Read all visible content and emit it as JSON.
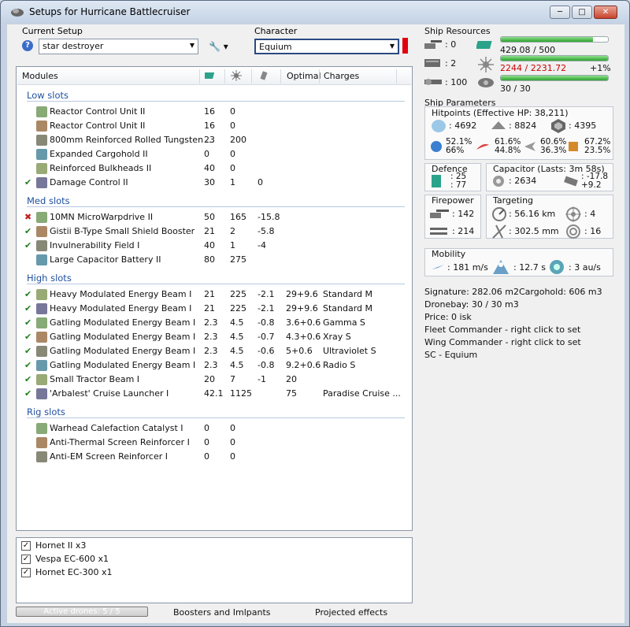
{
  "window": {
    "title": "Setups for Hurricane Battlecruiser"
  },
  "setup": {
    "label": "Current Setup",
    "value": "star destroyer"
  },
  "character": {
    "label": "Character",
    "value": "Equium"
  },
  "modules": {
    "headers": {
      "modules": "Modules",
      "optimal": "Optimal",
      "charges": "Charges"
    },
    "groups": [
      {
        "name": "Low slots",
        "rows": [
          {
            "mark": "",
            "name": "Reactor Control Unit II",
            "cpu": "16",
            "pg": "0",
            "cap": "",
            "opt": "",
            "charge": ""
          },
          {
            "mark": "",
            "name": "Reactor Control Unit II",
            "cpu": "16",
            "pg": "0",
            "cap": "",
            "opt": "",
            "charge": ""
          },
          {
            "mark": "",
            "name": "800mm Reinforced Rolled Tungsten ...",
            "cpu": "23",
            "pg": "200",
            "cap": "",
            "opt": "",
            "charge": ""
          },
          {
            "mark": "",
            "name": "Expanded Cargohold II",
            "cpu": "0",
            "pg": "0",
            "cap": "",
            "opt": "",
            "charge": ""
          },
          {
            "mark": "",
            "name": "Reinforced Bulkheads II",
            "cpu": "40",
            "pg": "0",
            "cap": "",
            "opt": "",
            "charge": ""
          },
          {
            "mark": "✔",
            "name": "Damage Control II",
            "cpu": "30",
            "pg": "1",
            "cap": "0",
            "opt": "",
            "charge": ""
          }
        ]
      },
      {
        "name": "Med slots",
        "rows": [
          {
            "mark": "✖",
            "name": "10MN MicroWarpdrive II",
            "cpu": "50",
            "pg": "165",
            "cap": "-15.8",
            "opt": "",
            "charge": ""
          },
          {
            "mark": "✔",
            "name": "Gistii B-Type Small Shield Booster",
            "cpu": "21",
            "pg": "2",
            "cap": "-5.8",
            "opt": "",
            "charge": ""
          },
          {
            "mark": "✔",
            "name": "Invulnerability Field I",
            "cpu": "40",
            "pg": "1",
            "cap": "-4",
            "opt": "",
            "charge": ""
          },
          {
            "mark": "",
            "name": "Large Capacitor Battery II",
            "cpu": "80",
            "pg": "275",
            "cap": "",
            "opt": "",
            "charge": ""
          }
        ]
      },
      {
        "name": "High slots",
        "rows": [
          {
            "mark": "✔",
            "name": "Heavy Modulated Energy Beam I",
            "cpu": "21",
            "pg": "225",
            "cap": "-2.1",
            "opt": "29+9.6",
            "charge": "Standard M"
          },
          {
            "mark": "✔",
            "name": "Heavy Modulated Energy Beam I",
            "cpu": "21",
            "pg": "225",
            "cap": "-2.1",
            "opt": "29+9.6",
            "charge": "Standard M"
          },
          {
            "mark": "✔",
            "name": "Gatling Modulated Energy Beam I",
            "cpu": "2.3",
            "pg": "4.5",
            "cap": "-0.8",
            "opt": "3.6+0.6",
            "charge": "Gamma S"
          },
          {
            "mark": "✔",
            "name": "Gatling Modulated Energy Beam I",
            "cpu": "2.3",
            "pg": "4.5",
            "cap": "-0.7",
            "opt": "4.3+0.6",
            "charge": "Xray S"
          },
          {
            "mark": "✔",
            "name": "Gatling Modulated Energy Beam I",
            "cpu": "2.3",
            "pg": "4.5",
            "cap": "-0.6",
            "opt": "5+0.6",
            "charge": "Ultraviolet S"
          },
          {
            "mark": "✔",
            "name": "Gatling Modulated Energy Beam I",
            "cpu": "2.3",
            "pg": "4.5",
            "cap": "-0.8",
            "opt": "9.2+0.6",
            "charge": "Radio S"
          },
          {
            "mark": "✔",
            "name": "Small Tractor Beam I",
            "cpu": "20",
            "pg": "7",
            "cap": "-1",
            "opt": "20",
            "charge": ""
          },
          {
            "mark": "✔",
            "name": "'Arbalest' Cruise Launcher I",
            "cpu": "42.1",
            "pg": "1125",
            "cap": "",
            "opt": "75",
            "charge": "Paradise Cruise ..."
          }
        ]
      },
      {
        "name": "Rig slots",
        "rows": [
          {
            "mark": "",
            "name": "Warhead Calefaction Catalyst I",
            "cpu": "0",
            "pg": "0",
            "cap": "",
            "opt": "",
            "charge": ""
          },
          {
            "mark": "",
            "name": "Anti-Thermal Screen Reinforcer I",
            "cpu": "0",
            "pg": "0",
            "cap": "",
            "opt": "",
            "charge": ""
          },
          {
            "mark": "",
            "name": "Anti-EM Screen Reinforcer I",
            "cpu": "0",
            "pg": "0",
            "cap": "",
            "opt": "",
            "charge": ""
          }
        ]
      }
    ]
  },
  "drones": [
    "Hornet II x3",
    "Vespa EC-600 x1",
    "Hornet EC-300 x1"
  ],
  "tabs": {
    "active_drones": "Active drones: 5 / 5",
    "boosters": "Boosters and Imlpants",
    "projected": "Projected effects"
  },
  "resources": {
    "title": "Ship Resources",
    "turrets": ": 0",
    "launchers": ": 2",
    "calibration": ": 100",
    "cpu": "429.08 / 500",
    "cpu_fill": 0.86,
    "pg": "2244 / 2231.72",
    "pg_pct": "+1%",
    "pg_fill": 1.0,
    "drone_bw": "30 / 30",
    "bw_fill": 1.0
  },
  "params": {
    "title": "Ship Parameters",
    "hp_title": "Hitpoints (Effective HP: 38,211)",
    "shield": ": 4692",
    "armor": ": 8824",
    "hull": ": 4395",
    "res": [
      [
        "52.1%",
        "66%"
      ],
      [
        "61.6%",
        "44.8%"
      ],
      [
        "60.6%",
        "36.3%"
      ],
      [
        "67.2%",
        "23.5%"
      ]
    ],
    "defence": "Defence",
    "def1": ": 25",
    "def2": ": 77",
    "capacitor": "Capacitor (Lasts: 3m 58s)",
    "cap_amount": ": 2634",
    "cap1": ": -17.8",
    "cap2": "+9.2",
    "firepower": "Firepower",
    "fp1": ": 142",
    "fp2": ": 214",
    "targeting": "Targeting",
    "range": ": 56.16 km",
    "targets": ": 4",
    "scan": ": 302.5 mm",
    "sigres": ": 16",
    "mobility": "Mobility",
    "speed": ": 181 m/s",
    "align": ": 12.7 s",
    "warp": ": 3 au/s"
  },
  "info": [
    "Signature: 282.06 m2",
    "Cargohold: 606 m3",
    "Dronebay: 30 / 30 m3",
    "Price: 0 isk",
    "Fleet Commander - right click to set",
    "Wing Commander - right click to set",
    "SC - Equium"
  ],
  "colors": {
    "group": "#2050a0",
    "ok": "#208020",
    "error": "#c02020",
    "overload": "#cc0000"
  }
}
